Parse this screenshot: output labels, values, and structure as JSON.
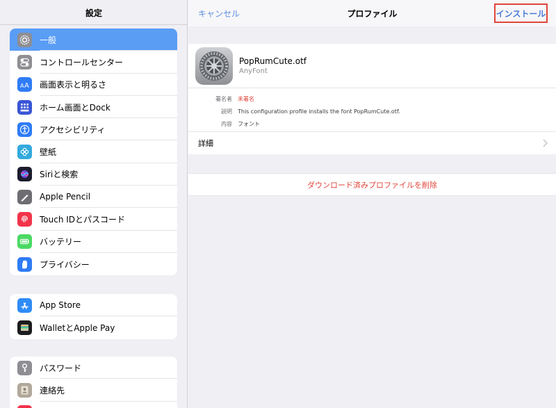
{
  "sidebar": {
    "title": "設定",
    "groups": [
      {
        "items": [
          {
            "label": "一般",
            "icon": "gear-icon",
            "color": "#8e8e93",
            "selected": true
          },
          {
            "label": "コントロールセンター",
            "icon": "toggles-icon",
            "color": "#8e8e93"
          },
          {
            "label": "画面表示と明るさ",
            "icon": "text-size-icon",
            "color": "#2f7cf6"
          },
          {
            "label": "ホーム画面とDock",
            "icon": "home-grid-icon",
            "color": "#3a55d6"
          },
          {
            "label": "アクセシビリティ",
            "icon": "accessibility-icon",
            "color": "#2f7cf6"
          },
          {
            "label": "壁紙",
            "icon": "flower-icon",
            "color": "#34aadc"
          },
          {
            "label": "Siriと検索",
            "icon": "siri-icon",
            "color": "#1c1c2e"
          },
          {
            "label": "Apple Pencil",
            "icon": "pencil-icon",
            "color": "#6d6d72"
          },
          {
            "label": "Touch IDとパスコード",
            "icon": "fingerprint-icon",
            "color": "#f2334a"
          },
          {
            "label": "バッテリー",
            "icon": "battery-icon",
            "color": "#4cd964"
          },
          {
            "label": "プライバシー",
            "icon": "hand-icon",
            "color": "#2f7cf6"
          }
        ]
      },
      {
        "items": [
          {
            "label": "App Store",
            "icon": "app-store-icon",
            "color": "#2f8cf6"
          },
          {
            "label": "WalletとApple Pay",
            "icon": "wallet-icon",
            "color": "#1c1c1e"
          }
        ]
      },
      {
        "items": [
          {
            "label": "パスワード",
            "icon": "key-icon",
            "color": "#8e8e93"
          },
          {
            "label": "連絡先",
            "icon": "contacts-icon",
            "color": "#b0a89a"
          },
          {
            "label": "",
            "icon": "calendar-icon",
            "color": "#f2334a"
          }
        ]
      }
    ]
  },
  "navbar": {
    "cancel_label": "キャンセル",
    "title": "プロファイル",
    "install_label": "インストール"
  },
  "profile": {
    "name": "PopRumCute.otf",
    "subtitle": "AnyFont",
    "fields": [
      {
        "key": "署名者",
        "value": "未署名",
        "status": "unsigned"
      },
      {
        "key": "説明",
        "value": "This configuration profile installs the font PopRumCute.otf."
      },
      {
        "key": "内容",
        "value": "フォント"
      }
    ],
    "details_label": "詳細"
  },
  "delete_label": "ダウンロード済みプロファイルを削除",
  "colors": {
    "accent_blue": "#5a8ee0",
    "destructive_red": "#e0453a",
    "selected_row": "#5a9df5"
  }
}
